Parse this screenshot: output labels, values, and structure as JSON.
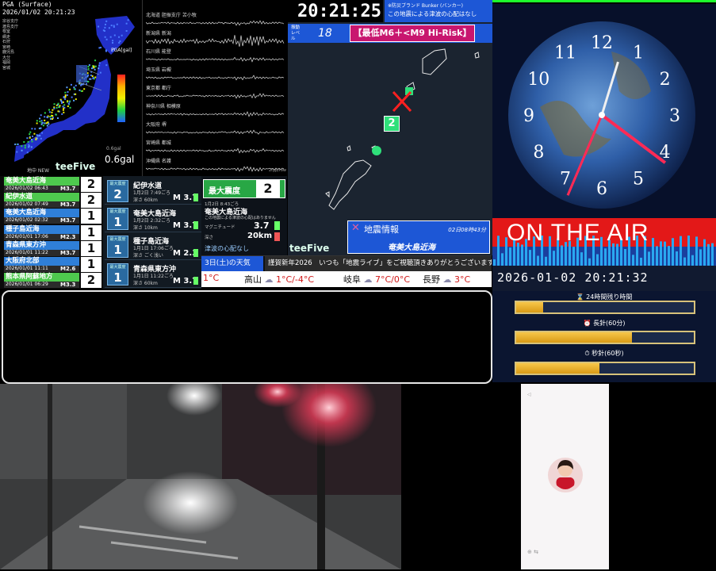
{
  "pga_panel": {
    "title": "PGA (Surface)",
    "datetime": "2026/01/02 20:21:23",
    "scale_title": "PGA[gal]",
    "gal_value": "0.6gal",
    "gal_small": "0.6gal",
    "footer": "地中 NEW",
    "brand": "teeFive",
    "legend_lines": [
      "宗谷支庁",
      "渡島支庁",
      "根室",
      "網走",
      "石狩",
      "宮崎",
      "鹿児島",
      "大分",
      "福岡",
      "宮城"
    ]
  },
  "waveforms": {
    "stations": [
      "北海道 胆振支庁 苫小牧",
      "新潟県 新潟",
      "石川県 能登",
      "埼玉県 岩槻",
      "東京都 都庁",
      "神奈川県 相模原",
      "大阪府 堺",
      "宮崎県 都城",
      "沖縄県 名護"
    ],
    "scale": "2typ/row"
  },
  "eq_list": [
    {
      "name": "奄美大島近海",
      "date": "2026/01/02 06:43",
      "mag": "M3.7",
      "shindo": "2",
      "color": "#4ec94e"
    },
    {
      "name": "紀伊水道",
      "date": "2026/01/02 07:49",
      "mag": "M3.7",
      "shindo": "2",
      "color": "#4ec94e"
    },
    {
      "name": "奄美大島近海",
      "date": "2026/01/02 02:32",
      "mag": "M3.7",
      "shindo": "1",
      "color": "#2f7fd8"
    },
    {
      "name": "種子島近海",
      "date": "2026/01/01 17:06",
      "mag": "M2.3",
      "shindo": "1",
      "color": "#2f7fd8"
    },
    {
      "name": "青森県東方沖",
      "date": "2026/01/01 11:22",
      "mag": "M3.7",
      "shindo": "1",
      "color": "#2f7fd8"
    },
    {
      "name": "大阪府北部",
      "date": "2026/01/01 11:11",
      "mag": "M2.6",
      "shindo": "1",
      "color": "#2f7fd8"
    },
    {
      "name": "熊本県阿蘇地方",
      "date": "2026/01/01 06:29",
      "mag": "M3.3",
      "shindo": "2",
      "color": "#4ec94e"
    }
  ],
  "eq_cards": [
    {
      "badge_label": "最大震度",
      "shindo": "2",
      "place": "紀伊水道",
      "time": "1月2日 7:49ごろ",
      "depth": "深さ 60km",
      "mag": "M 3.7"
    },
    {
      "badge_label": "最大震度",
      "shindo": "1",
      "place": "奄美大島近海",
      "time": "1月2日 2:32ごろ",
      "depth": "深さ 10km",
      "mag": "M 3.7"
    },
    {
      "badge_label": "最大震度",
      "shindo": "1",
      "place": "種子島近海",
      "time": "1月1日 17:06ごろ",
      "depth": "深さ ごく浅い",
      "mag": "M 2.3"
    },
    {
      "badge_label": "最大震度",
      "shindo": "1",
      "place": "青森県東方沖",
      "time": "1月1日 11:22ごろ",
      "depth": "深さ 60km",
      "mag": "M 3.7"
    }
  ],
  "max_intensity": {
    "label": "最大震度",
    "value": "2",
    "time": "1月2日 8:43ごろ",
    "place": "奄美大島近海",
    "note": "この地震による津波の心配はありません",
    "mag_label": "マグニチュード",
    "mag": "3.7",
    "depth_label": "深さ",
    "depth": "20km",
    "tsunami": "津波の心配なし"
  },
  "map_panel": {
    "clock": "20:21:25",
    "banner": "※防災ブランド Bunker (バンカー)",
    "subbanner": "この地震による津波の心配はなし",
    "level_label": "振動レベル",
    "level": "18",
    "risk": "【最低M6＋<M9 Hi-Risk】",
    "intensity_marker": "2",
    "info_title": "地震情報",
    "info_time": "02日08時43分",
    "info_place": "奄美大島近海",
    "brand": "teeFive"
  },
  "ticker": {
    "weather_title": "3日(土)の天気",
    "message": "謹賀新年2026　いつも「地震ライブ」をご視聴頂きありがとうございます!",
    "cities": [
      {
        "name": "",
        "temp": "1°C"
      },
      {
        "name": "高山",
        "temp": "1°C/-4°C"
      },
      {
        "name": "岐阜",
        "temp": "7°C/0°C"
      },
      {
        "name": "長野",
        "temp": "3°C"
      }
    ]
  },
  "clock_panel": {
    "numerals": [
      "12",
      "1",
      "2",
      "3",
      "4",
      "5",
      "6",
      "7",
      "8",
      "9",
      "10",
      "11"
    ],
    "hour_hand_angle": 2,
    "minute_hand_angle": 127,
    "second_hand_angle": 203
  },
  "onair": {
    "text": "ON THE AIR"
  },
  "datetime_display": {
    "value": "2026-01-02 20:21:32"
  },
  "remaining": {
    "label1": "24時間残り時間",
    "fill1": 0.15,
    "label2": "長針(60分)",
    "fill2": 0.65,
    "label3": "秒針(60秒)",
    "fill3": 0.47
  },
  "message_box": {
    "text": ""
  },
  "colors": {
    "accent_green": "#1dfc2c",
    "magenta": "#c8166f",
    "blue_banner": "#1d57d6",
    "red": "#e02020"
  }
}
